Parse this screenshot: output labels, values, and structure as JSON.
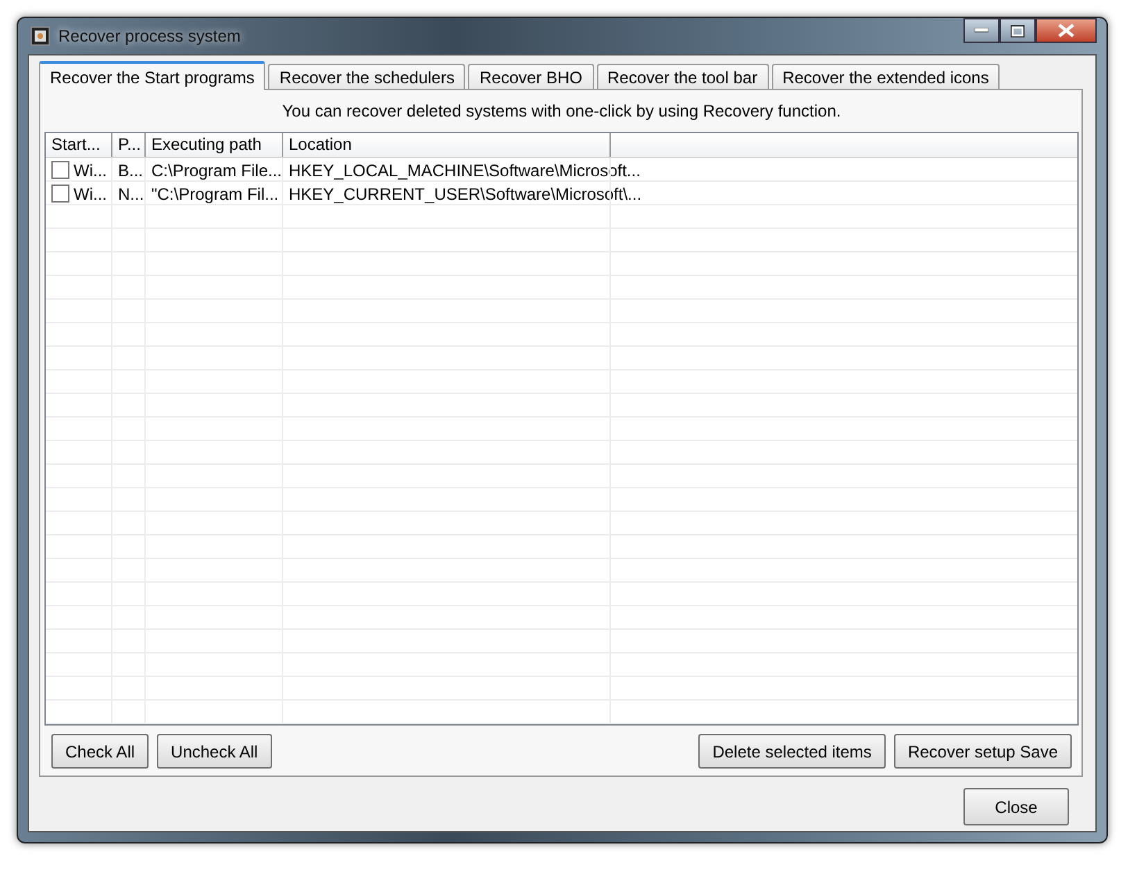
{
  "window": {
    "title": "Recover process system"
  },
  "tabs": [
    {
      "label": "Recover the Start programs",
      "selected": true
    },
    {
      "label": "Recover the schedulers",
      "selected": false
    },
    {
      "label": "Recover BHO",
      "selected": false
    },
    {
      "label": "Recover the tool bar",
      "selected": false
    },
    {
      "label": "Recover the extended icons",
      "selected": false
    }
  ],
  "info": "You can recover deleted systems with one-click by using Recovery function.",
  "table": {
    "columns": [
      "Start...",
      "P...",
      "Executing path",
      "Location"
    ],
    "rows": [
      {
        "checked": false,
        "cells": [
          "Wi...",
          "B...",
          "C:\\Program File...",
          "HKEY_LOCAL_MACHINE\\Software\\Microsoft..."
        ]
      },
      {
        "checked": false,
        "cells": [
          "Wi...",
          "N...",
          "\"C:\\Program Fil...",
          "HKEY_CURRENT_USER\\Software\\Microsoft\\..."
        ]
      }
    ]
  },
  "left_buttons": [
    "Check All",
    "Uncheck All"
  ],
  "right_buttons": [
    "Delete selected items",
    "Recover setup Save"
  ],
  "close_button": "Close"
}
